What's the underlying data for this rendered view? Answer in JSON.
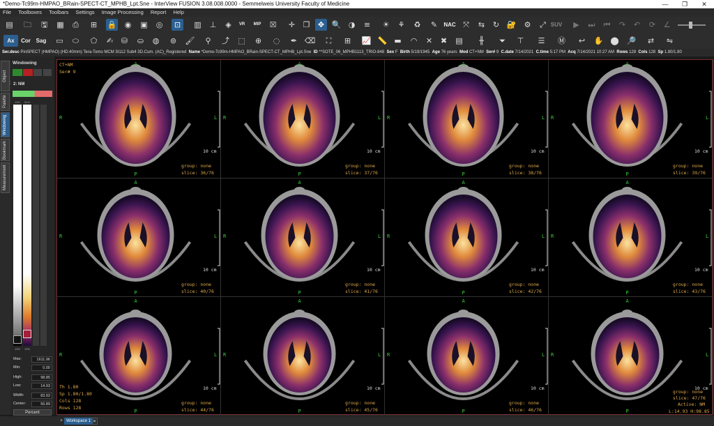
{
  "window": {
    "title": "*Demo-Tc99m-HMPAO_BRain-SPECT-CT_MPHB_Lpt.Sne - InterView FUSION 3.08.008.0000 - Semmelweis University Faculty of Medicine",
    "minimize": "—",
    "maximize": "❐",
    "close": "✕"
  },
  "menu": [
    "File",
    "Toolboxes",
    "Toolbars",
    "Settings",
    "Image Processing",
    "Report",
    "Help"
  ],
  "toolbar2": {
    "ax": "Ax",
    "cor": "Cor",
    "sag": "Sag"
  },
  "toolbar1": {
    "nac": "NAC",
    "suv": "SUV",
    "vr": "VR",
    "mip": "MIP"
  },
  "info": {
    "ser_desc_label": "Ser.desc",
    "ser_desc": "PinSPECT (HMPAO) (HD:40mm) Tera-Tomo MCM 3I112 Sub4 3D.Cum. (AC)_Registered",
    "name_label": "Name",
    "name": "*Demo-Tc99m-HMPAO_BRain-SPECT-CT_MPHB_Lpt.Sne",
    "id_label": "ID",
    "id": "**SOTE_06_MPHB1113_TRIO-848",
    "sex_label": "Sex",
    "sex": "F",
    "birth_label": "Birth",
    "birth": "5/19/1945",
    "age_label": "Age",
    "age": "76 years",
    "mod_label": "Mod",
    "mod": "CT+NM",
    "ser_label": "Ser#",
    "ser": "9",
    "cdate_label": "C.date",
    "cdate": "7/14/2021",
    "ctime_label": "C.time",
    "ctime": "5:17 PM",
    "acq_label": "Acq",
    "acq": "7/14/2021 10:27 AM",
    "rows_label": "Rows",
    "rows": "128",
    "cols_label": "Cols",
    "cols": "128",
    "sp_label": "Sp",
    "sp": "1.80/1.80"
  },
  "side_tabs": [
    "Object Manager",
    "Palette",
    "Windowing",
    "Bookmark",
    "Measurement"
  ],
  "windowing": {
    "title": "Windowing",
    "layer": "2: NM",
    "pct_top_left": "13%",
    "pct_top_right": "51%",
    "pct_bottom_left": "13%",
    "pct_bottom_right": "13%",
    "max_label": "Max:",
    "max": "1611.96",
    "min_label": "Min:",
    "min": "0.00",
    "high_label": "High:",
    "high": "98.85",
    "low_label": "Low:",
    "low": "14.93",
    "width_label": "Width:",
    "width": "83.92",
    "center_label": "Center:",
    "center": "56.89",
    "mode_button": "Percent"
  },
  "viewport": {
    "top_left_1": "CT+NM",
    "top_left_2": "Ser# 9",
    "anterior": "A",
    "posterior": "P",
    "right": "R",
    "left": "L",
    "scale": "10 cm",
    "group": "group: none",
    "bottom_left": [
      "Th 1.80",
      "Sp 1.80/1.80",
      "Cols 128",
      "Rows 128"
    ],
    "last_active": "Active: NM",
    "last_lh": "L:14.93 H:98.85",
    "slices": [
      "slice: 36/76",
      "slice: 37/76",
      "slice: 38/76",
      "slice: 39/76",
      "slice: 40/76",
      "slice: 41/76",
      "slice: 42/76",
      "slice: 43/76",
      "slice: 44/76",
      "slice: 45/76",
      "slice: 46/76",
      "slice: 47/76"
    ]
  },
  "status": {
    "workspace_tab": "Workspace 1",
    "add": "+"
  },
  "colors": {
    "accent": "#2c5f8f",
    "overlay_text": "#e0a94a",
    "orientation": "#3bd13b",
    "border": "#7a2a2a"
  }
}
